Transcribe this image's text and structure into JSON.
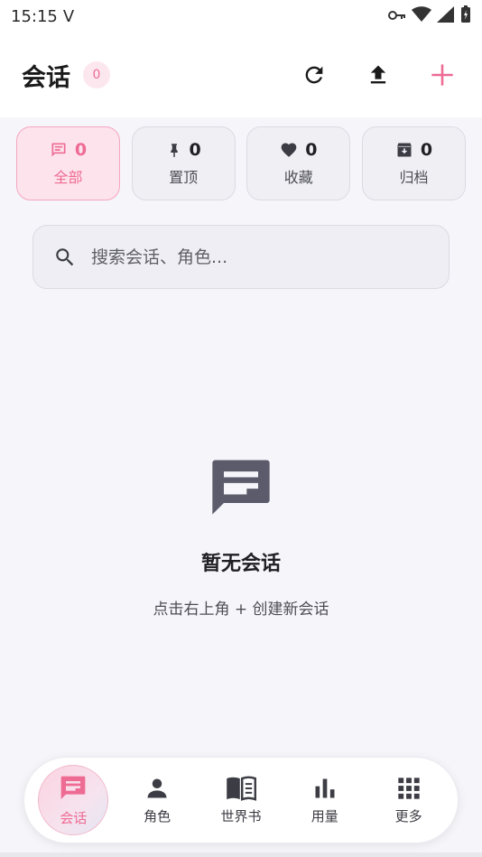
{
  "status_bar": {
    "time": "15:15",
    "carrier_icon": "V"
  },
  "header": {
    "title": "会话",
    "count": "0"
  },
  "filters": [
    {
      "label": "全部",
      "count": "0",
      "icon": "chat-icon",
      "active": true
    },
    {
      "label": "置顶",
      "count": "0",
      "icon": "pin-icon",
      "active": false
    },
    {
      "label": "收藏",
      "count": "0",
      "icon": "heart-icon",
      "active": false
    },
    {
      "label": "归档",
      "count": "0",
      "icon": "archive-icon",
      "active": false
    }
  ],
  "search": {
    "placeholder": "搜索会话、角色..."
  },
  "empty_state": {
    "title": "暂无会话",
    "subtitle": "点击右上角 + 创建新会话"
  },
  "bottom_nav": [
    {
      "label": "会话",
      "icon": "chat-icon",
      "active": true
    },
    {
      "label": "角色",
      "icon": "person-icon",
      "active": false
    },
    {
      "label": "世界书",
      "icon": "book-icon",
      "active": false
    },
    {
      "label": "用量",
      "icon": "bar-chart-icon",
      "active": false
    },
    {
      "label": "更多",
      "icon": "grid-icon",
      "active": false
    }
  ],
  "colors": {
    "accent": "#ee6b94",
    "background": "#f6f5fa"
  }
}
